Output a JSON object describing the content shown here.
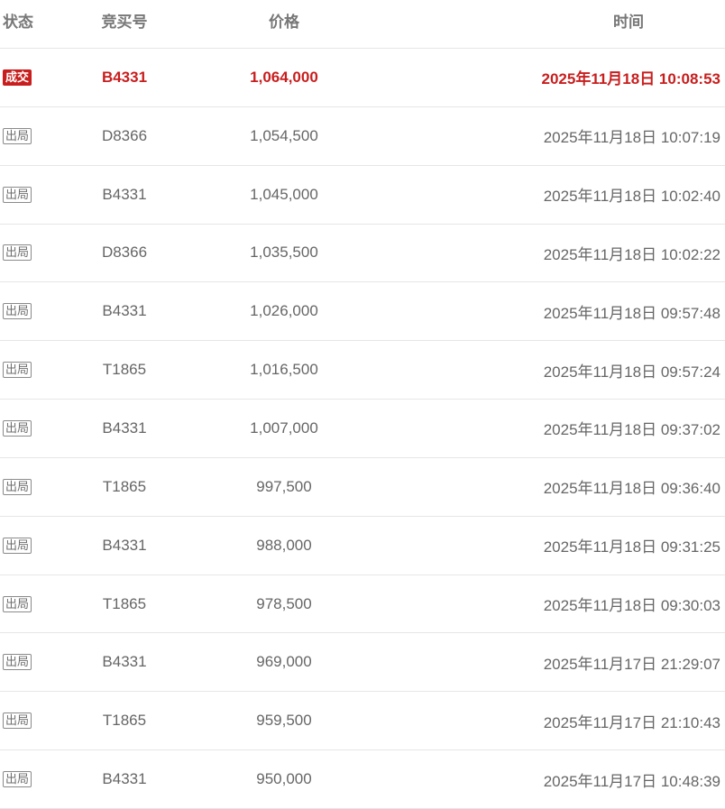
{
  "headers": {
    "status": "状态",
    "bidder": "竞买号",
    "price": "价格",
    "time": "时间"
  },
  "colors": {
    "accent_red": "#c81e1e",
    "text_gray": "#666666",
    "divider": "#e6e6e6"
  },
  "rows": [
    {
      "status": "成交",
      "status_type": "deal",
      "bidder": "B4331",
      "price": "1,064,000",
      "time": "2025年11月18日 10:08:53"
    },
    {
      "status": "出局",
      "status_type": "out",
      "bidder": "D8366",
      "price": "1,054,500",
      "time": "2025年11月18日 10:07:19"
    },
    {
      "status": "出局",
      "status_type": "out",
      "bidder": "B4331",
      "price": "1,045,000",
      "time": "2025年11月18日 10:02:40"
    },
    {
      "status": "出局",
      "status_type": "out",
      "bidder": "D8366",
      "price": "1,035,500",
      "time": "2025年11月18日 10:02:22"
    },
    {
      "status": "出局",
      "status_type": "out",
      "bidder": "B4331",
      "price": "1,026,000",
      "time": "2025年11月18日 09:57:48"
    },
    {
      "status": "出局",
      "status_type": "out",
      "bidder": "T1865",
      "price": "1,016,500",
      "time": "2025年11月18日 09:57:24"
    },
    {
      "status": "出局",
      "status_type": "out",
      "bidder": "B4331",
      "price": "1,007,000",
      "time": "2025年11月18日 09:37:02"
    },
    {
      "status": "出局",
      "status_type": "out",
      "bidder": "T1865",
      "price": "997,500",
      "time": "2025年11月18日 09:36:40"
    },
    {
      "status": "出局",
      "status_type": "out",
      "bidder": "B4331",
      "price": "988,000",
      "time": "2025年11月18日 09:31:25"
    },
    {
      "status": "出局",
      "status_type": "out",
      "bidder": "T1865",
      "price": "978,500",
      "time": "2025年11月18日 09:30:03"
    },
    {
      "status": "出局",
      "status_type": "out",
      "bidder": "B4331",
      "price": "969,000",
      "time": "2025年11月17日 21:29:07"
    },
    {
      "status": "出局",
      "status_type": "out",
      "bidder": "T1865",
      "price": "959,500",
      "time": "2025年11月17日 21:10:43"
    },
    {
      "status": "出局",
      "status_type": "out",
      "bidder": "B4331",
      "price": "950,000",
      "time": "2025年11月17日 10:48:39"
    }
  ]
}
